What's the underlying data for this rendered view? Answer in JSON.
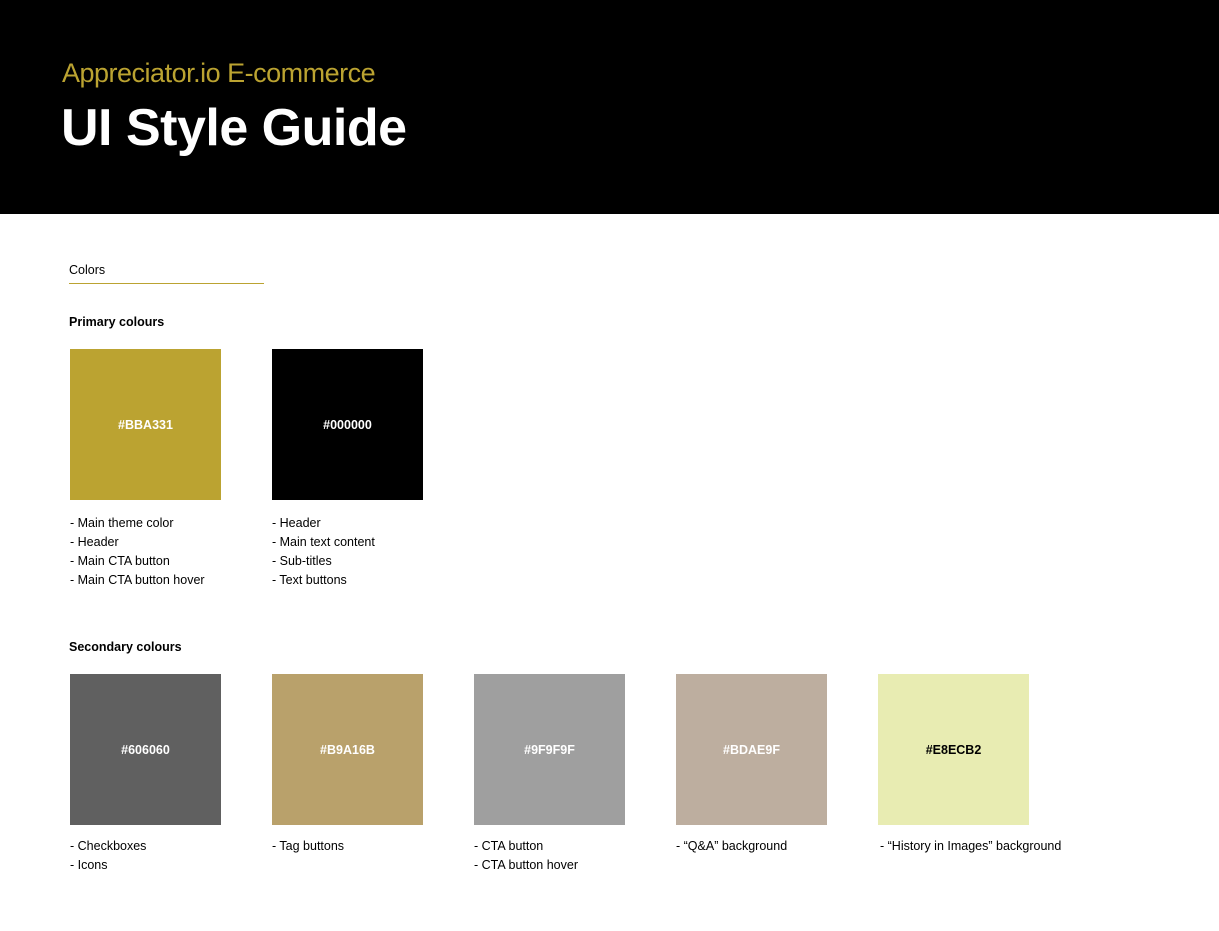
{
  "header": {
    "subtitle": "Appreciator.io E-commerce",
    "title": "UI Style Guide"
  },
  "section_label": "Colors",
  "primary": {
    "title": "Primary colours",
    "swatches": [
      {
        "code": "#BBA331",
        "color": "#BBA331",
        "text_color": "#FFFFFF",
        "usage": [
          "- Main theme color",
          "- Header",
          "- Main CTA button",
          "- Main CTA button hover"
        ]
      },
      {
        "code": "#000000",
        "color": "#000000",
        "text_color": "#FFFFFF",
        "usage": [
          "- Header",
          "- Main text content",
          "- Sub-titles",
          "- Text buttons"
        ]
      }
    ]
  },
  "secondary": {
    "title": "Secondary colours",
    "swatches": [
      {
        "code": "#606060",
        "color": "#606060",
        "text_color": "#FFFFFF",
        "usage": [
          "- Checkboxes",
          "- Icons"
        ]
      },
      {
        "code": "#B9A16B",
        "color": "#B9A16B",
        "text_color": "#FFFFFF",
        "usage": [
          "- Tag buttons"
        ]
      },
      {
        "code": "#9F9F9F",
        "color": "#9F9F9F",
        "text_color": "#FFFFFF",
        "usage": [
          "- CTA button",
          "- CTA button hover"
        ]
      },
      {
        "code": "#BDAE9F",
        "color": "#BDAE9F",
        "text_color": "#FFFFFF",
        "usage": [
          "- “Q&A” background"
        ]
      },
      {
        "code": "#E8ECB2",
        "color": "#E8ECB2",
        "text_color": "#000000",
        "usage": [
          "- “History in Images” background"
        ]
      }
    ]
  },
  "colors": {
    "header_bg": "#000000",
    "subtitle": "#BBA331",
    "accent_rule": "#BBA331"
  }
}
